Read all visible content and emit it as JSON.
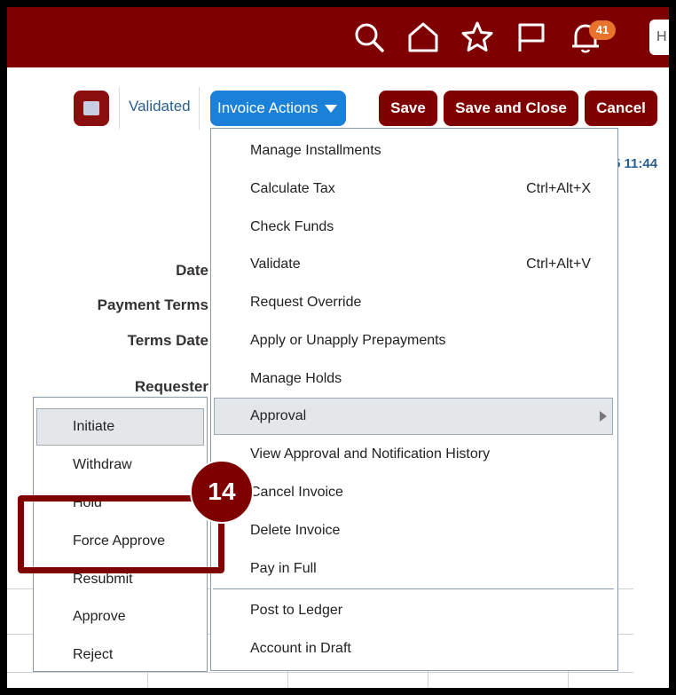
{
  "header": {
    "icons": [
      "search-icon",
      "home-icon",
      "star-icon",
      "flag-icon",
      "bell-icon"
    ],
    "notification_count": "41",
    "search_stub": "H"
  },
  "toolbar": {
    "status": "Validated",
    "invoice_actions_label": "Invoice Actions",
    "save_label": "Save",
    "save_and_close_label": "Save and Close",
    "cancel_label": "Cancel"
  },
  "form": {
    "labels": {
      "date": "Date",
      "payment_terms": "Payment Terms",
      "terms_date": "Terms Date",
      "requester": "Requester"
    },
    "time_fragment": "5 11:44"
  },
  "invoice_menu": {
    "items": [
      {
        "label": "Manage Installments",
        "shortcut": ""
      },
      {
        "label": "Calculate Tax",
        "shortcut": "Ctrl+Alt+X"
      },
      {
        "label": "Check Funds",
        "shortcut": ""
      },
      {
        "label": "Validate",
        "shortcut": "Ctrl+Alt+V"
      },
      {
        "label": "Request Override",
        "shortcut": ""
      },
      {
        "label": "Apply or Unapply Prepayments",
        "shortcut": ""
      },
      {
        "label": "Manage Holds",
        "shortcut": ""
      },
      {
        "label": "Approval",
        "shortcut": ""
      },
      {
        "label": "View Approval and Notification History",
        "shortcut": ""
      },
      {
        "label": "Cancel Invoice",
        "shortcut": ""
      },
      {
        "label": "Delete Invoice",
        "shortcut": ""
      },
      {
        "label": "Pay in Full",
        "shortcut": ""
      },
      {
        "label": "Post to Ledger",
        "shortcut": ""
      },
      {
        "label": "Account in Draft",
        "shortcut": ""
      }
    ]
  },
  "approval_submenu": {
    "items": [
      {
        "label": "Initiate"
      },
      {
        "label": "Withdraw"
      },
      {
        "label": "Hold"
      },
      {
        "label": "Force Approve"
      },
      {
        "label": "Resubmit"
      },
      {
        "label": "Approve"
      },
      {
        "label": "Reject"
      }
    ]
  },
  "callout": {
    "step": "14"
  },
  "colors": {
    "brand": "#7f0000",
    "accent_button": "#1a80d8",
    "badge": "#e8732c",
    "link_text": "#2a5f8f"
  }
}
